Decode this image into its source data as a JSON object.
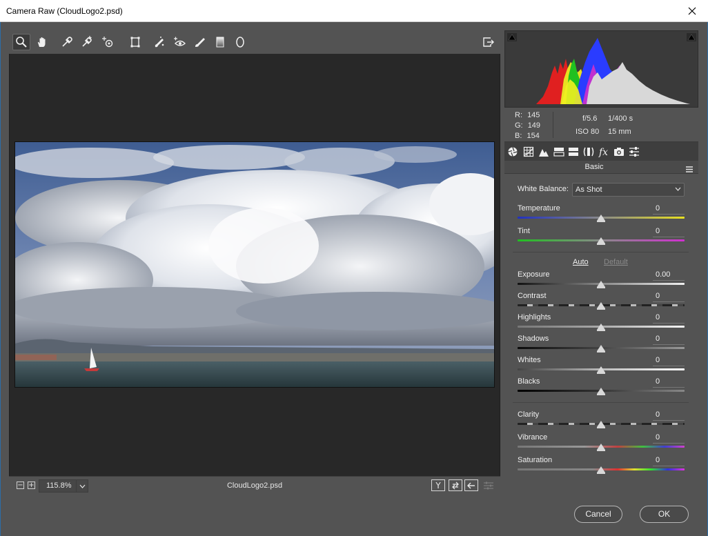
{
  "window": {
    "title": "Camera Raw (CloudLogo2.psd)"
  },
  "toolbar": {
    "tools": [
      {
        "name": "zoom-tool",
        "icon": "magnifier-icon"
      },
      {
        "name": "hand-tool",
        "icon": "hand-icon"
      },
      {
        "name": "white-balance-tool",
        "icon": "eyedropper-icon"
      },
      {
        "name": "color-sampler-tool",
        "icon": "eyedropper-plus-icon"
      },
      {
        "name": "targeted-adjustment-tool",
        "icon": "target-icon"
      },
      {
        "name": "transform-tool",
        "icon": "transform-icon"
      },
      {
        "name": "spot-removal-tool",
        "icon": "brush-spot-icon"
      },
      {
        "name": "red-eye-tool",
        "icon": "eye-icon"
      },
      {
        "name": "adjustment-brush-tool",
        "icon": "brush-icon"
      },
      {
        "name": "graduated-filter-tool",
        "icon": "gradient-icon"
      },
      {
        "name": "radial-filter-tool",
        "icon": "ellipse-icon"
      }
    ]
  },
  "bottom_bar": {
    "zoom_minus": "−",
    "zoom_plus": "+",
    "zoom_level": "115.8%",
    "filename": "CloudLogo2.psd",
    "view_button": "Y"
  },
  "info": {
    "r_label": "R:",
    "r_value": "145",
    "g_label": "G:",
    "g_value": "149",
    "b_label": "B:",
    "b_value": "154",
    "aperture": "f/5.6",
    "shutter": "1/400 s",
    "iso": "ISO 80",
    "focal": "15 mm"
  },
  "panel": {
    "section_title": "Basic",
    "white_balance_label": "White Balance:",
    "white_balance_value": "As Shot",
    "auto_label": "Auto",
    "default_label": "Default",
    "sliders": [
      {
        "label": "Temperature",
        "value": "0"
      },
      {
        "label": "Tint",
        "value": "0"
      },
      {
        "label": "Exposure",
        "value": "0.00"
      },
      {
        "label": "Contrast",
        "value": "0"
      },
      {
        "label": "Highlights",
        "value": "0"
      },
      {
        "label": "Shadows",
        "value": "0"
      },
      {
        "label": "Whites",
        "value": "0"
      },
      {
        "label": "Blacks",
        "value": "0"
      },
      {
        "label": "Clarity",
        "value": "0"
      },
      {
        "label": "Vibrance",
        "value": "0"
      },
      {
        "label": "Saturation",
        "value": "0"
      }
    ]
  },
  "footer": {
    "cancel_label": "Cancel",
    "ok_label": "OK"
  },
  "colors": {
    "panel_bg": "#535353",
    "canvas_bg": "#282828",
    "histogram_bg": "#3a3a3a"
  }
}
